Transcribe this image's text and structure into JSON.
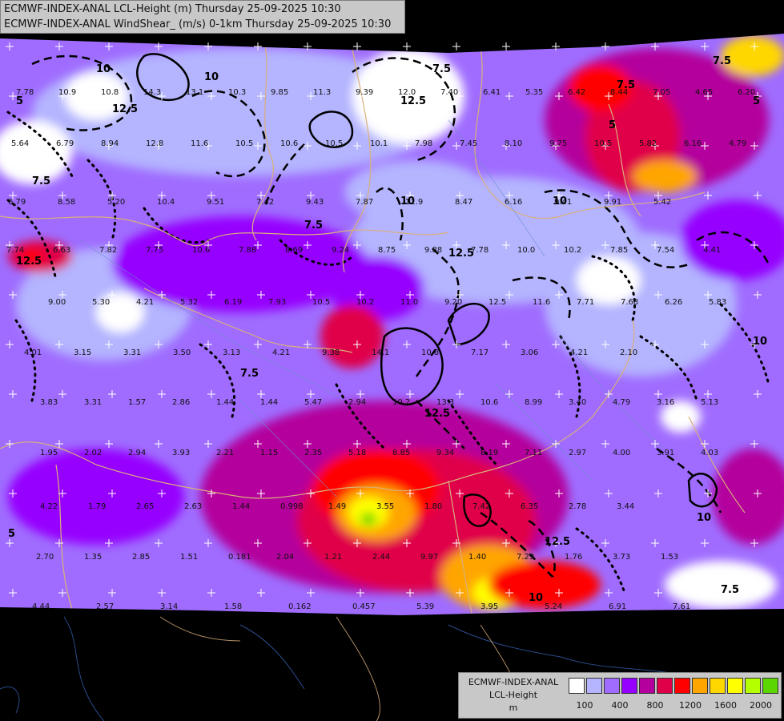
{
  "header": {
    "line1": "ECMWF-INDEX-ANAL LCL-Height (m) Thursday 25-09-2025 10:30",
    "line2": "ECMWF-INDEX-ANAL WindShear_ (m/s) 0-1km Thursday 25-09-2025 10:30"
  },
  "legend": {
    "title_lines": [
      "ECMWF-INDEX-ANAL",
      "LCL-Height",
      "m"
    ],
    "colors": [
      "#ffffff",
      "#b4b4ff",
      "#9f6cff",
      "#9600ff",
      "#b4009c",
      "#e0004a",
      "#ff0000",
      "#ffa500",
      "#ffd700",
      "#ffff00",
      "#b4ff00",
      "#5cd600",
      "#2e9c2e",
      "#00a88c",
      "#00bfff"
    ],
    "tick_labels": [
      "100",
      "400",
      "800",
      "1200",
      "1600",
      "2000"
    ]
  },
  "contour_labels": {
    "levels": [
      "5",
      "7.5",
      "10",
      "12.5"
    ]
  },
  "station_values": [
    {
      "v": "7.78"
    },
    {
      "v": "10.9"
    },
    {
      "v": "10.8"
    },
    {
      "v": "14.3"
    },
    {
      "v": "13.1"
    },
    {
      "v": "10.3"
    },
    {
      "v": "9.85"
    },
    {
      "v": "11.3"
    },
    {
      "v": "9.39"
    },
    {
      "v": "12.0"
    },
    {
      "v": "7.40"
    },
    {
      "v": "6.41"
    },
    {
      "v": "5.35"
    },
    {
      "v": "6.42"
    },
    {
      "v": "8.44"
    },
    {
      "v": "7.05"
    },
    {
      "v": "4.65"
    },
    {
      "v": "6.20"
    },
    {
      "v": "5.64"
    },
    {
      "v": "6.79"
    },
    {
      "v": "8.94"
    },
    {
      "v": "12.8"
    },
    {
      "v": "11.6"
    },
    {
      "v": "10.5"
    },
    {
      "v": "10.6"
    },
    {
      "v": "10.5"
    },
    {
      "v": "10.1"
    },
    {
      "v": "7.98"
    },
    {
      "v": "7.45"
    },
    {
      "v": "8.10"
    },
    {
      "v": "9.75"
    },
    {
      "v": "10.5"
    },
    {
      "v": "5.82"
    },
    {
      "v": "6.16"
    },
    {
      "v": "4.79"
    },
    {
      "v": "6.79"
    },
    {
      "v": "8.58"
    },
    {
      "v": "5.20"
    },
    {
      "v": "10.4"
    },
    {
      "v": "9.51"
    },
    {
      "v": "7.42"
    },
    {
      "v": "9.43"
    },
    {
      "v": "7.87"
    },
    {
      "v": "11.9"
    },
    {
      "v": "8.47"
    },
    {
      "v": "6.16"
    },
    {
      "v": "9.41"
    },
    {
      "v": "9.91"
    },
    {
      "v": "5.42"
    },
    {
      "v": "7.74"
    },
    {
      "v": "6.63"
    },
    {
      "v": "7.82"
    },
    {
      "v": "7.75"
    },
    {
      "v": "10.6"
    },
    {
      "v": "7.88"
    },
    {
      "v": "8.69"
    },
    {
      "v": "9.24"
    },
    {
      "v": "8.75"
    },
    {
      "v": "9.88"
    },
    {
      "v": "7.78"
    },
    {
      "v": "10.0"
    },
    {
      "v": "10.2"
    },
    {
      "v": "7.85"
    },
    {
      "v": "7.54"
    },
    {
      "v": "4.41"
    },
    {
      "v": "9.00"
    },
    {
      "v": "5.30"
    },
    {
      "v": "4.21"
    },
    {
      "v": "5.32"
    },
    {
      "v": "6.19"
    },
    {
      "v": "7.93"
    },
    {
      "v": "10.5"
    },
    {
      "v": "10.2"
    },
    {
      "v": "11.0"
    },
    {
      "v": "9.20"
    },
    {
      "v": "12.5"
    },
    {
      "v": "11.6"
    },
    {
      "v": "7.71"
    },
    {
      "v": "7.68"
    },
    {
      "v": "6.26"
    },
    {
      "v": "5.83"
    },
    {
      "v": "4.01"
    },
    {
      "v": "3.15"
    },
    {
      "v": "3.31"
    },
    {
      "v": "3.50"
    },
    {
      "v": "3.13"
    },
    {
      "v": "4.21"
    },
    {
      "v": "9.38"
    },
    {
      "v": "14.1"
    },
    {
      "v": "10.8"
    },
    {
      "v": "7.17"
    },
    {
      "v": "3.06"
    },
    {
      "v": "4.21"
    },
    {
      "v": "2.10"
    },
    {
      "v": "3.83"
    },
    {
      "v": "3.31"
    },
    {
      "v": "1.57"
    },
    {
      "v": "2.86"
    },
    {
      "v": "1.44"
    },
    {
      "v": "1.44"
    },
    {
      "v": "5.47"
    },
    {
      "v": "2.94"
    },
    {
      "v": "10.2"
    },
    {
      "v": "13.3"
    },
    {
      "v": "10.6"
    },
    {
      "v": "8.99"
    },
    {
      "v": "3.40"
    },
    {
      "v": "4.79"
    },
    {
      "v": "3.16"
    },
    {
      "v": "5.13"
    },
    {
      "v": "1.95"
    },
    {
      "v": "2.02"
    },
    {
      "v": "2.94"
    },
    {
      "v": "3.93"
    },
    {
      "v": "2.21"
    },
    {
      "v": "1.15"
    },
    {
      "v": "2.35"
    },
    {
      "v": "5.18"
    },
    {
      "v": "8.85"
    },
    {
      "v": "9.34"
    },
    {
      "v": "8.19"
    },
    {
      "v": "7.11"
    },
    {
      "v": "2.97"
    },
    {
      "v": "4.00"
    },
    {
      "v": "3.91"
    },
    {
      "v": "4.03"
    },
    {
      "v": "4.22"
    },
    {
      "v": "1.79"
    },
    {
      "v": "2.65"
    },
    {
      "v": "2.63"
    },
    {
      "v": "1.44"
    },
    {
      "v": "0.998"
    },
    {
      "v": "1.49"
    },
    {
      "v": "3.55"
    },
    {
      "v": "1.80"
    },
    {
      "v": "7.42"
    },
    {
      "v": "6.35"
    },
    {
      "v": "2.78"
    },
    {
      "v": "3.44"
    },
    {
      "v": "2.70"
    },
    {
      "v": "1.35"
    },
    {
      "v": "2.85"
    },
    {
      "v": "1.51"
    },
    {
      "v": "0.181"
    },
    {
      "v": "2.04"
    },
    {
      "v": "1.21"
    },
    {
      "v": "2.44"
    },
    {
      "v": "9.97"
    },
    {
      "v": "1.40"
    },
    {
      "v": "7.29"
    },
    {
      "v": "1.76"
    },
    {
      "v": "3.73"
    },
    {
      "v": "1.53"
    },
    {
      "v": "4.44"
    },
    {
      "v": "2.57"
    },
    {
      "v": "3.14"
    },
    {
      "v": "1.58"
    },
    {
      "v": "0.162"
    },
    {
      "v": "0.457"
    },
    {
      "v": "5.39"
    },
    {
      "v": "3.95"
    },
    {
      "v": "5.24"
    },
    {
      "v": "6.91"
    },
    {
      "v": "7.61"
    }
  ]
}
